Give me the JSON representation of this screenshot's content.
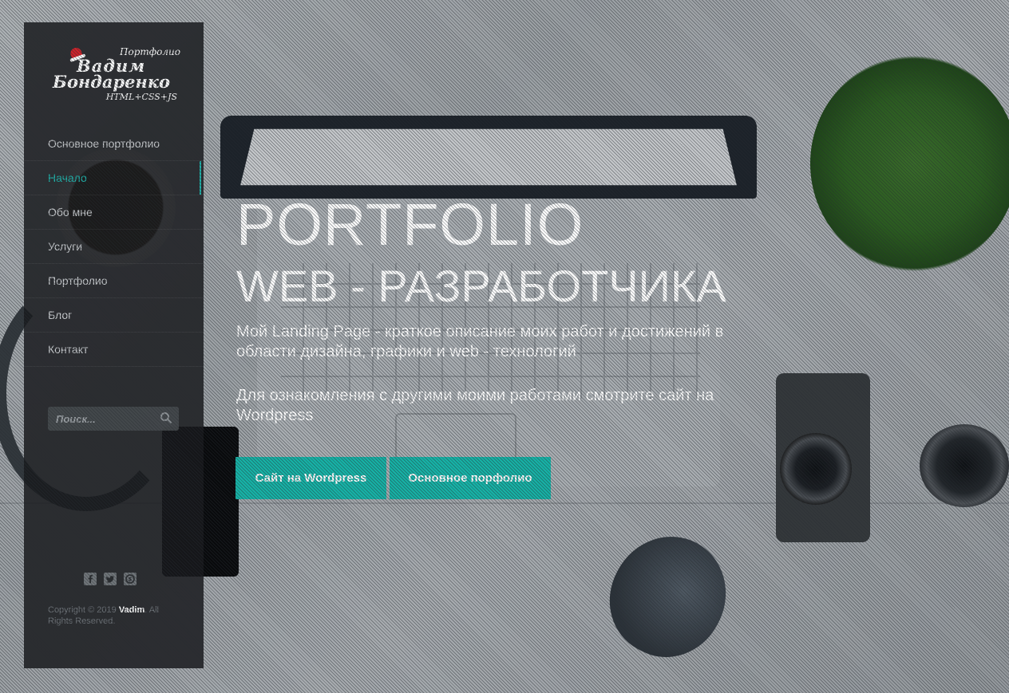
{
  "logo": {
    "portfolio": "Портфолио",
    "line1": "Вадим",
    "line2": "Бондаренко",
    "tagline": "HTML+CSS+JS"
  },
  "sidebar": {
    "items": [
      {
        "label": "Основное портфолио",
        "active": false
      },
      {
        "label": "Начало",
        "active": true
      },
      {
        "label": "Обо мне",
        "active": false
      },
      {
        "label": "Услуги",
        "active": false
      },
      {
        "label": "Портфолио",
        "active": false
      },
      {
        "label": "Блог",
        "active": false
      },
      {
        "label": "Контакт",
        "active": false
      }
    ],
    "search_placeholder": "Поиск...",
    "social_icons": [
      "facebook-icon",
      "twitter-icon",
      "skype-icon"
    ],
    "copyright": {
      "prefix": "Copyright © 2019",
      "author": "Vadim",
      "suffix": ". All Rights Reserved."
    }
  },
  "hero": {
    "title": "PORTFOLIO",
    "subtitle": "WEB - РАЗРАБОТЧИКА",
    "description": "Мой Landing Page - краткое описание моих работ и достижений в области дизайна, графики и web - технологий",
    "note": "Для ознакомления с другими моими работами смотрите сайт на Wordpress",
    "buttons": [
      {
        "label": "Сайт на Wordpress"
      },
      {
        "label": "Основное порфолио"
      }
    ]
  },
  "colors": {
    "accent": "#16b3a7",
    "sidebar_bg": "#181a1c",
    "menu_text": "#c9cccf"
  }
}
